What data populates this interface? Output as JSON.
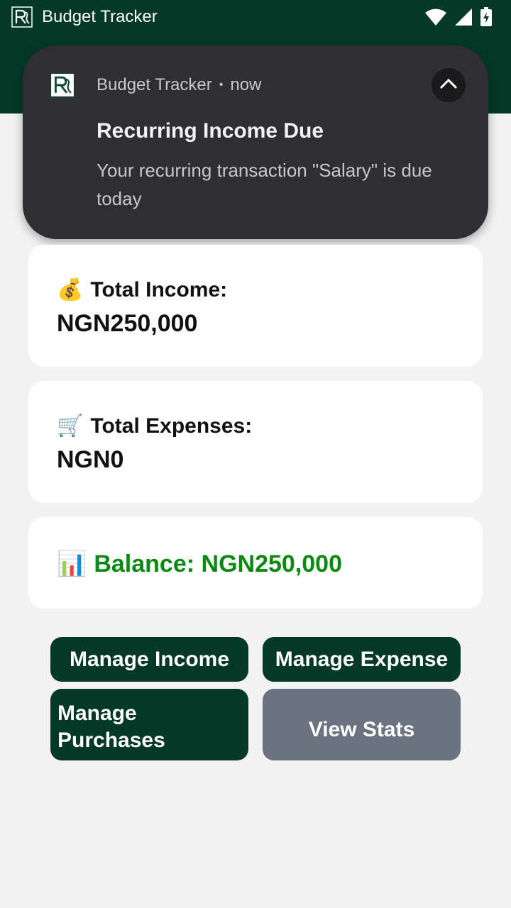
{
  "status_bar": {
    "app_name": "Budget Tracker",
    "icons": [
      "app-logo-icon",
      "wifi-icon",
      "signal-icon",
      "battery-charging-icon"
    ]
  },
  "notification": {
    "app_name": "Budget Tracker",
    "time": "now",
    "title": "Recurring Income Due",
    "body": "Your recurring transaction \"Salary\" is due today",
    "icons": [
      "app-logo-icon",
      "chevron-up-icon"
    ]
  },
  "cards": {
    "income": {
      "emoji": "💰",
      "label": "Total Income:",
      "value": "NGN250,000"
    },
    "expenses": {
      "emoji": "🛒",
      "label": "Total Expenses:",
      "value": "NGN0"
    },
    "balance": {
      "emoji": "📊",
      "label": "Balance: NGN250,000"
    }
  },
  "buttons": {
    "manage_income": "Manage Income",
    "manage_expense": "Manage Expense",
    "manage_purchases": "Manage Purchases",
    "view_stats": "View Stats"
  },
  "colors": {
    "brand_green": "#043927",
    "balance_green": "#0b8a12",
    "disabled_gray": "#6b7280",
    "notification_bg": "#2f2f33",
    "page_bg": "#f2f2f2"
  }
}
